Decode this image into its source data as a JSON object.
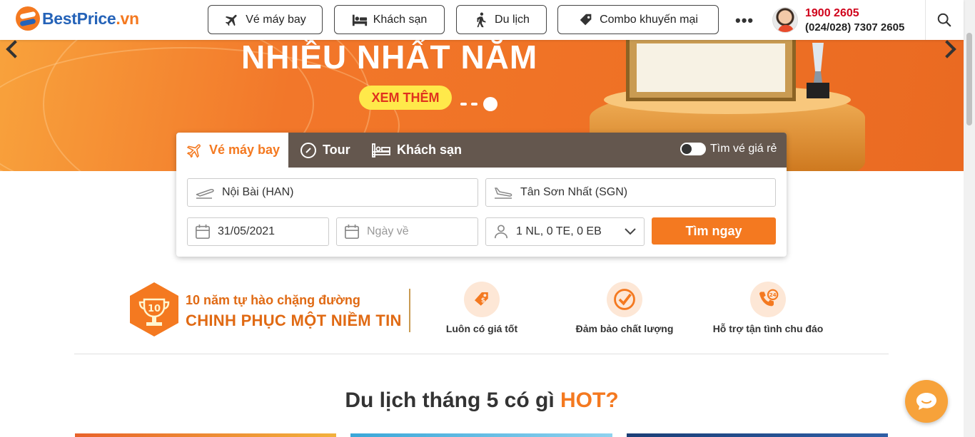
{
  "logo": {
    "brand": "BestPrice",
    "tld": ".vn"
  },
  "nav": [
    {
      "label": "Vé máy bay",
      "icon": "airplane-icon"
    },
    {
      "label": "Khách sạn",
      "icon": "bed-icon"
    },
    {
      "label": "Du lịch",
      "icon": "traveler-icon"
    },
    {
      "label": "Combo khuyến mại",
      "icon": "tag-icon"
    }
  ],
  "more_label": "•••",
  "hotline": {
    "primary": "1900 2605",
    "secondary": "(024/028) 7307 2605"
  },
  "banner": {
    "title": "NHIỀU NHẤT NĂM",
    "cta": "XEM THÊM"
  },
  "search": {
    "tabs": [
      {
        "label": "Vé máy bay",
        "active": true
      },
      {
        "label": "Tour"
      },
      {
        "label": "Khách sạn"
      }
    ],
    "cheap_toggle": "Tìm vé giá rẻ",
    "from": "Nội Bài (HAN)",
    "to": "Tân Sơn Nhất (SGN)",
    "depart_date": "31/05/2021",
    "return_placeholder": "Ngày về",
    "passengers": "1 NL, 0 TE, 0 EB",
    "submit": "Tìm ngay"
  },
  "features": {
    "badge_number": "10",
    "tagline1": "10 năm tự hào chặng đường",
    "tagline2": "CHINH PHỤC MỘT NIỀM TIN",
    "usps": [
      "Luôn có giá tốt",
      "Đảm bảo chất lượng",
      "Hỗ trợ tận tình chu đáo"
    ]
  },
  "section": {
    "title": "Du lịch tháng 5 có gì ",
    "highlight": "HOT?"
  },
  "colors": {
    "accent": "#f47920",
    "brand_blue": "#2563b8",
    "hotline_red": "#d0021b"
  }
}
